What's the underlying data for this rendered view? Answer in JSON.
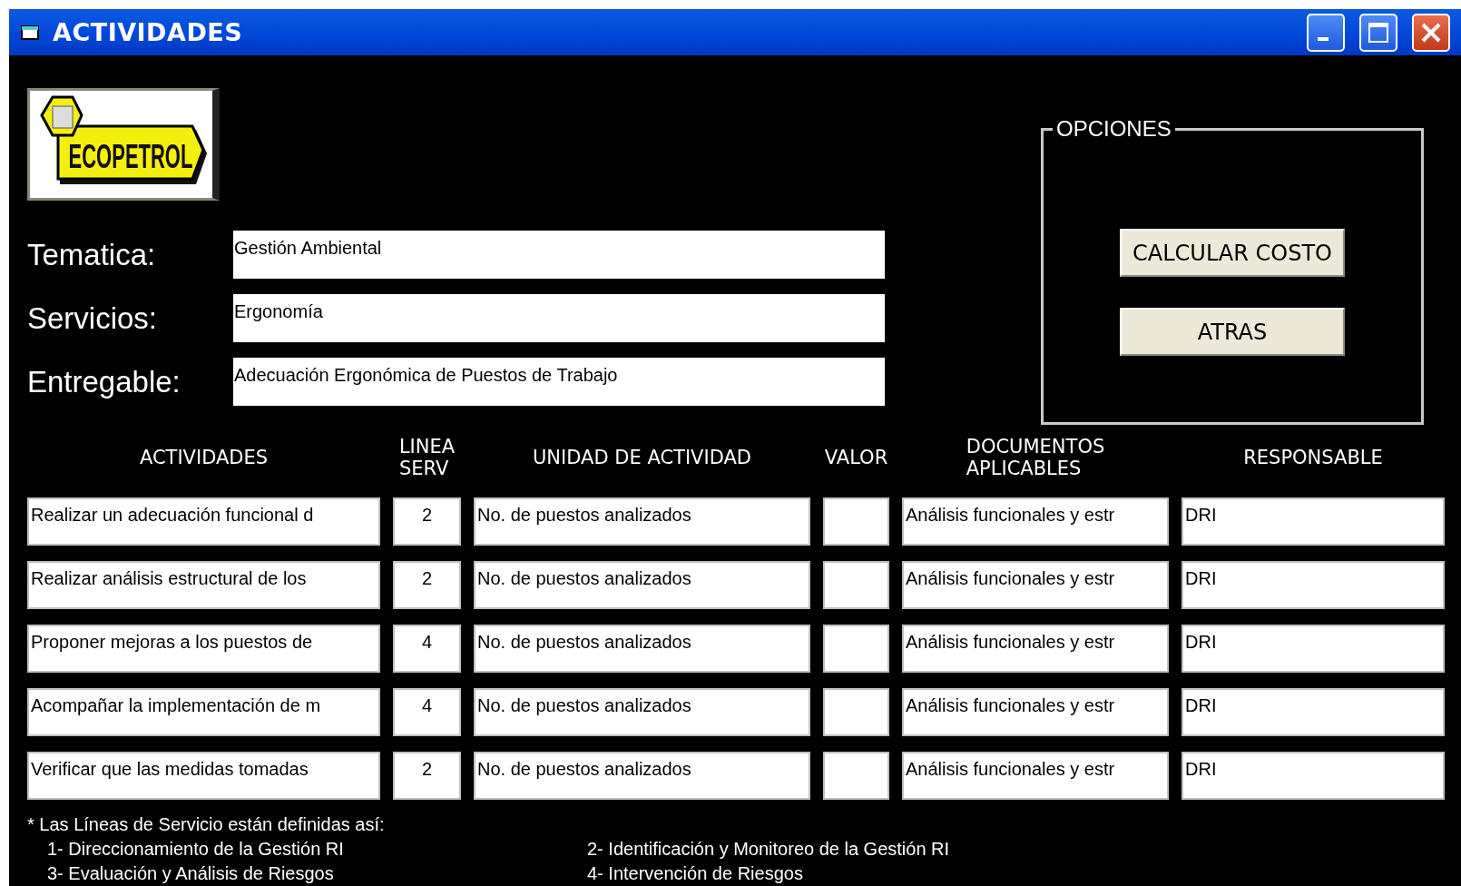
{
  "window": {
    "title": "ACTIVIDADES"
  },
  "logo": {
    "text": "ECOPETROL"
  },
  "fields": [
    {
      "label": "Tematica:",
      "value": "Gestión Ambiental"
    },
    {
      "label": "Servicios:",
      "value": "Ergonomía"
    },
    {
      "label": "Entregable:",
      "value": "Adecuación Ergonómica de Puestos de Trabajo"
    }
  ],
  "options": {
    "title": "OPCIONES",
    "buttons": [
      "CALCULAR COSTO",
      "ATRAS"
    ]
  },
  "table": {
    "columns": [
      "ACTIVIDADES",
      "LINEA\nSERV",
      "UNIDAD DE ACTIVIDAD",
      "VALOR",
      "DOCUMENTOS\nAPLICABLES",
      "RESPONSABLE"
    ],
    "rows": [
      {
        "actividad": "Realizar un adecuación funcional d",
        "linea": "2",
        "unidad": "No. de puestos analizados",
        "documentos": "Análisis funcionales y estr",
        "responsable": "DRI"
      },
      {
        "actividad": "Realizar análisis estructural de los",
        "linea": "2",
        "unidad": "No. de puestos analizados",
        "documentos": "Análisis funcionales y estr",
        "responsable": "DRI"
      },
      {
        "actividad": "Proponer mejoras a los puestos de",
        "linea": "4",
        "unidad": "No. de puestos analizados",
        "documentos": "Análisis funcionales y estr",
        "responsable": "DRI"
      },
      {
        "actividad": "Acompañar la implementación de m",
        "linea": "4",
        "unidad": "No. de puestos analizados",
        "documentos": "Análisis funcionales y estr",
        "responsable": "DRI"
      },
      {
        "actividad": "Verificar que las medidas tomadas",
        "linea": "2",
        "unidad": "No. de puestos analizados",
        "documentos": "Análisis funcionales y estr",
        "responsable": "DRI"
      }
    ]
  },
  "footnote": {
    "title": "* Las Líneas de Servicio están definidas así:",
    "items": [
      "1- Direccionamiento de la Gestión RI",
      "2- Identificación y Monitoreo de la Gestión RI",
      "3- Evaluación y Análisis de Riesgos",
      "4- Intervención de Riesgos"
    ]
  }
}
